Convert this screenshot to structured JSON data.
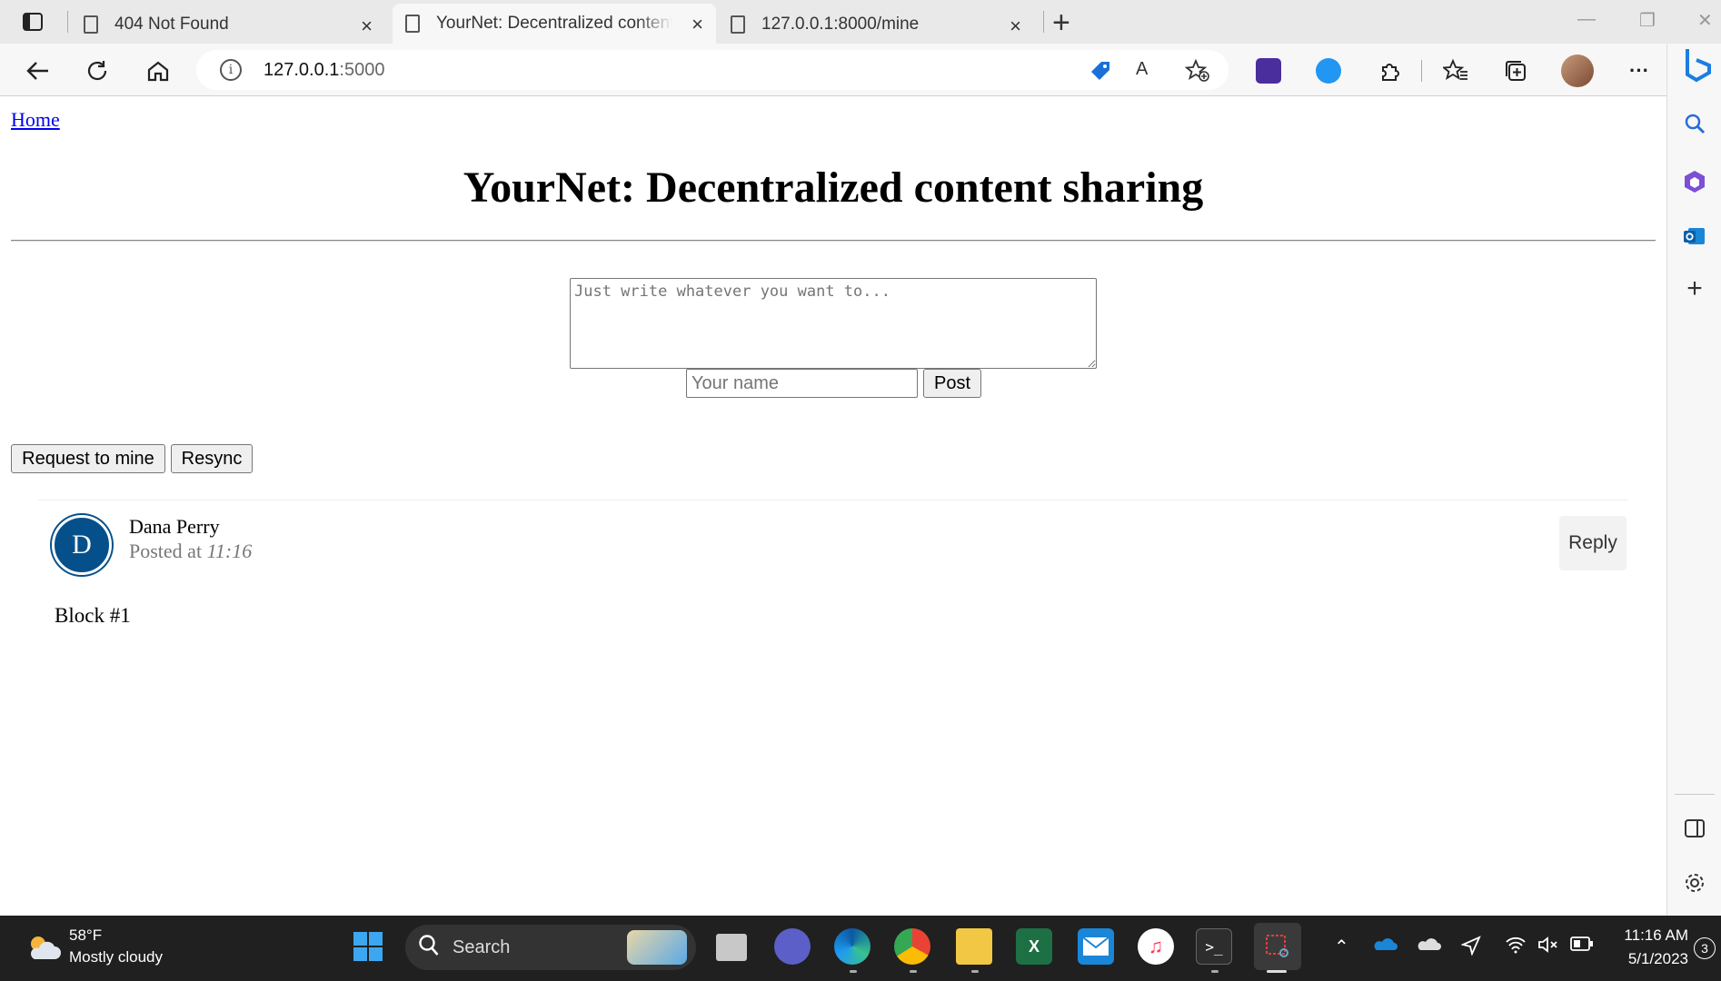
{
  "browser": {
    "tabs": [
      {
        "title": "404 Not Found"
      },
      {
        "title": "YourNet: Decentralized content s"
      },
      {
        "title": "127.0.0.1:8000/mine"
      }
    ],
    "close_glyph": "×",
    "new_tab_glyph": "+",
    "url_host": "127.0.0.1",
    "url_port": ":5000",
    "info_glyph": "i",
    "read_aloud_glyph": "A",
    "more_glyph": "···"
  },
  "page": {
    "home_link": "Home",
    "title": "YourNet: Decentralized content sharing",
    "textarea_placeholder": "Just write whatever you want to...",
    "name_placeholder": "Your name",
    "post_button": "Post",
    "request_mine_button": "Request to mine",
    "resync_button": "Resync",
    "posts": [
      {
        "avatar_letter": "D",
        "author": "Dana Perry",
        "posted_prefix": "Posted at",
        "time": "11:16",
        "reply": "Reply",
        "content": "Block #1"
      }
    ]
  },
  "taskbar": {
    "temperature": "58°F",
    "condition": "Mostly cloudy",
    "search_label": "Search",
    "time": "11:16 AM",
    "date": "5/1/2023",
    "notification_count": "3"
  },
  "colors": {
    "avatar_bg": "#05508a",
    "link": "#0000ee",
    "taskbar_bg": "#202020"
  }
}
